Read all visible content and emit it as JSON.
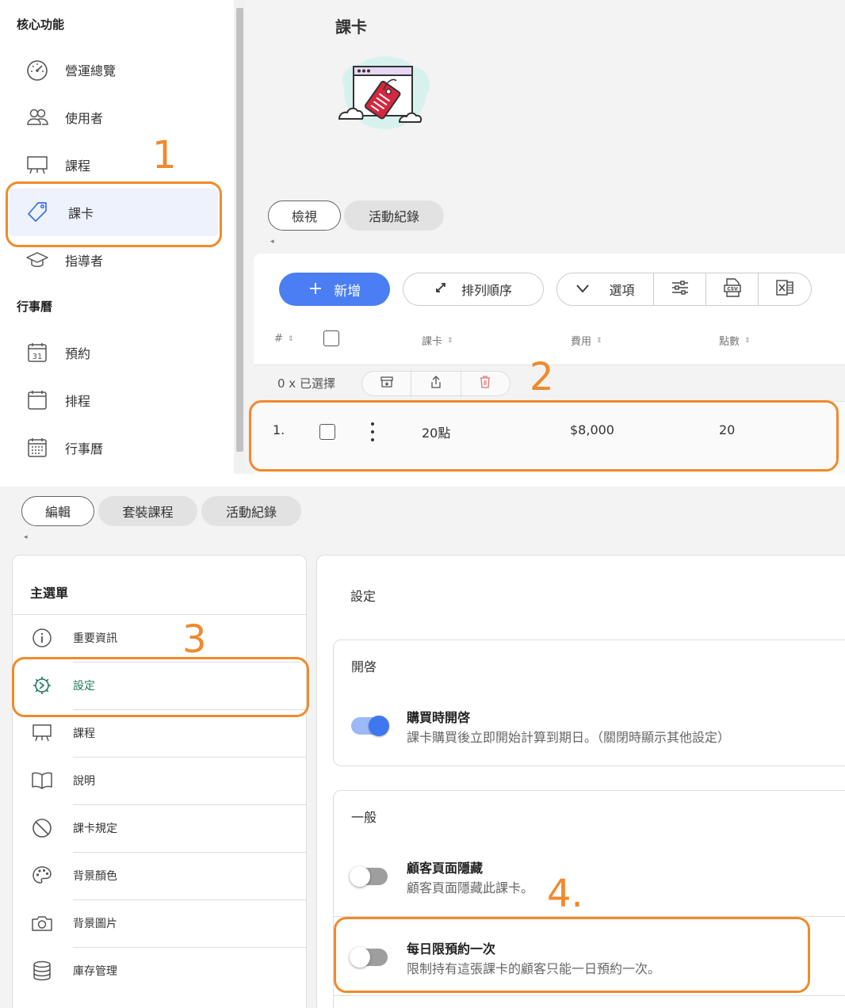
{
  "top": {
    "sidebar": {
      "section_core": "核心功能",
      "section_calendar": "行事曆",
      "items": [
        {
          "label": "營運總覽"
        },
        {
          "label": "使用者"
        },
        {
          "label": "課程"
        },
        {
          "label": "課卡"
        },
        {
          "label": "指導者"
        },
        {
          "label": "預約"
        },
        {
          "label": "排程"
        },
        {
          "label": "行事曆"
        }
      ],
      "calendar_day": "31"
    },
    "page_title": "課卡",
    "tabs": [
      {
        "label": "檢視"
      },
      {
        "label": "活動紀錄"
      }
    ],
    "toolbar": {
      "new_label": "新增",
      "new_icon": "plus",
      "sort_label": "排列順序",
      "options_label": "選項",
      "csv_label": "CSV"
    },
    "table": {
      "headers": [
        {
          "label": "#"
        },
        {
          "label": "課卡"
        },
        {
          "label": "費用"
        },
        {
          "label": "點數"
        }
      ],
      "selected_text": "0 x 已選擇",
      "rows": [
        {
          "index": "1.",
          "name": "20點",
          "price": "$8,000",
          "points": "20"
        }
      ]
    }
  },
  "bottom": {
    "tabs": [
      {
        "label": "編輯"
      },
      {
        "label": "套裝課程"
      },
      {
        "label": "活動紀錄"
      }
    ],
    "menu": {
      "title": "主選單",
      "items": [
        {
          "label": "重要資訊",
          "icon": "info-icon"
        },
        {
          "label": "設定",
          "icon": "gear-icon"
        },
        {
          "label": "課程",
          "icon": "easel-icon"
        },
        {
          "label": "說明",
          "icon": "book-icon"
        },
        {
          "label": "課卡規定",
          "icon": "prohibited-icon"
        },
        {
          "label": "背景顏色",
          "icon": "palette-icon"
        },
        {
          "label": "背景圖片",
          "icon": "camera-icon"
        },
        {
          "label": "庫存管理",
          "icon": "database-icon"
        }
      ]
    },
    "settings": {
      "title": "設定",
      "groups": [
        {
          "title": "開啓",
          "items": [
            {
              "title": "購買時開啓",
              "desc": "課卡購買後立即開始計算到期日。（關閉時顯示其他設定）",
              "on": true
            }
          ]
        },
        {
          "title": "一般",
          "items": [
            {
              "title": "顧客頁面隱藏",
              "desc": "顧客頁面隱藏此課卡。",
              "on": false
            },
            {
              "title": "每日限預約一次",
              "desc": "限制持有這張課卡的顧客只能一日預約一次。",
              "on": false
            }
          ]
        }
      ]
    }
  },
  "annotations": [
    "1",
    "2",
    "3",
    "4."
  ],
  "colors": {
    "accent": "#4a7ef2",
    "annotation": "#f08a2c",
    "active_nav_bg": "#eef2fd",
    "active_menu_text": "#1f7a5c",
    "delete_icon": "#e57373"
  }
}
